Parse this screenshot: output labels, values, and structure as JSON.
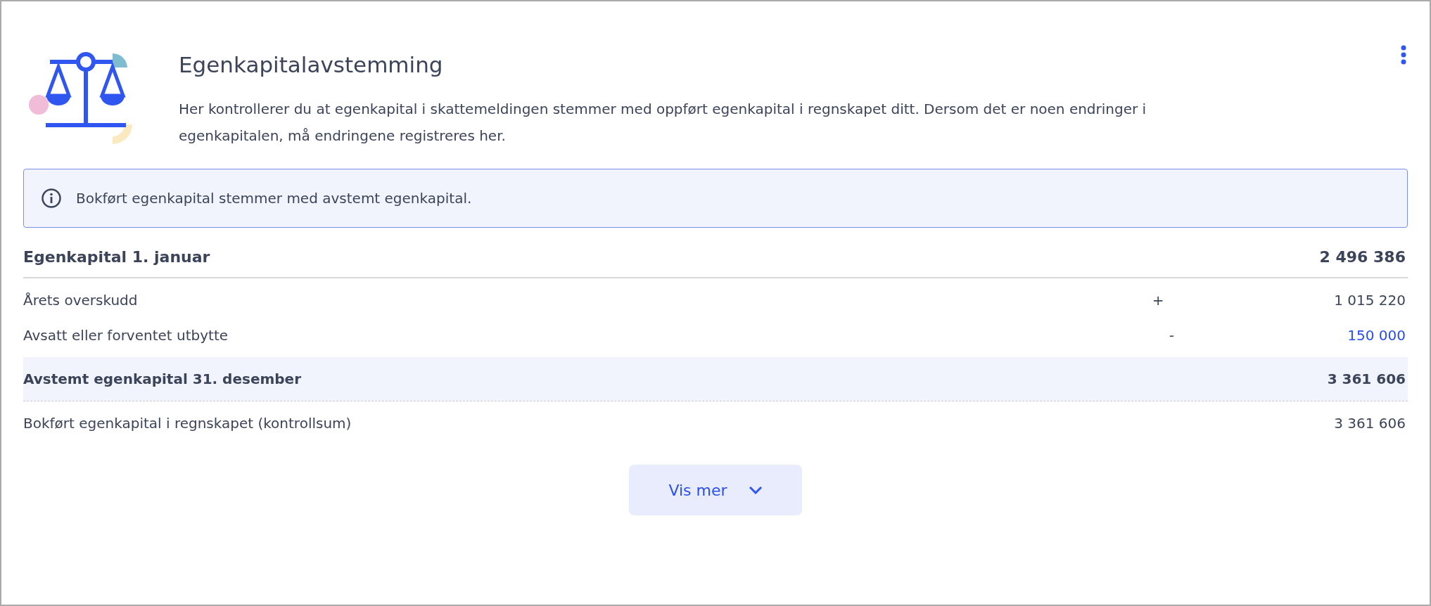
{
  "header": {
    "title": "Egenkapitalavstemming",
    "description": "Her kontrollerer du at egenkapital i skattemeldingen stemmer med oppført egenkapital i regnskapet ditt. Dersom det er noen endringer i egenkapitalen, må endringene registreres her."
  },
  "info": {
    "message": "Bokført egenkapital stemmer med avstemt egenkapital."
  },
  "rows": [
    {
      "kind": "total",
      "label": "Egenkapital 1. januar",
      "value": "2 496 386",
      "link": false
    },
    {
      "kind": "line",
      "label": "Årets overskudd",
      "sign": "+",
      "value": "1 015 220",
      "link": false
    },
    {
      "kind": "line",
      "label": "Avsatt eller forventet utbytte",
      "sign": "-",
      "value": "150 000",
      "link": true
    },
    {
      "kind": "sum",
      "label": "Avstemt egenkapital 31. desember",
      "value": "3 361 606",
      "link": false
    },
    {
      "kind": "control",
      "label": "Bokført egenkapital i regnskapet (kontrollsum)",
      "value": "3 361 606",
      "link": false
    }
  ],
  "show_more": {
    "label": "Vis mer"
  }
}
